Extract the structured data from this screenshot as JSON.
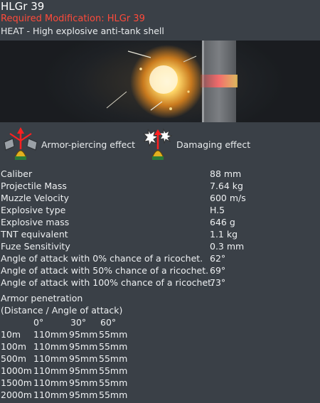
{
  "header": {
    "title": "HLGr 39",
    "required_modification": "Required Modification: HLGr 39",
    "description": "HEAT - High explosive anti-tank shell"
  },
  "effects": [
    {
      "label": "Armor-piercing effect",
      "icon": "armor-piercing-icon"
    },
    {
      "label": "Damaging effect",
      "icon": "damaging-effect-icon"
    }
  ],
  "stats": [
    {
      "label": "Caliber",
      "value": "88 mm"
    },
    {
      "label": "Projectile Mass",
      "value": "7.64 kg"
    },
    {
      "label": "Muzzle Velocity",
      "value": "600 m/s"
    },
    {
      "label": "Explosive type",
      "value": "H.5"
    },
    {
      "label": "Explosive mass",
      "value": "646 g"
    },
    {
      "label": "TNT equivalent",
      "value": "1.1 kg"
    },
    {
      "label": "Fuze Sensitivity",
      "value": "0.3 mm"
    },
    {
      "label": "Angle of attack with 0% chance of a ricochet.",
      "value": "62°"
    },
    {
      "label": "Angle of attack with 50% chance of a ricochet.",
      "value": "69°"
    },
    {
      "label": "Angle of attack with 100% chance of a ricochet.",
      "value": "73°"
    }
  ],
  "penetration": {
    "title": "Armor penetration",
    "subtitle": "(Distance / Angle of attack)",
    "angles": [
      "0°",
      "30°",
      "60°"
    ],
    "rows": [
      {
        "distance": "10m",
        "values": [
          "110mm",
          "95mm",
          "55mm"
        ]
      },
      {
        "distance": "100m",
        "values": [
          "110mm",
          "95mm",
          "55mm"
        ]
      },
      {
        "distance": "500m",
        "values": [
          "110mm",
          "95mm",
          "55mm"
        ]
      },
      {
        "distance": "1000m",
        "values": [
          "110mm",
          "95mm",
          "55mm"
        ]
      },
      {
        "distance": "1500m",
        "values": [
          "110mm",
          "95mm",
          "55mm"
        ]
      },
      {
        "distance": "2000m",
        "values": [
          "110mm",
          "95mm",
          "55mm"
        ]
      }
    ]
  }
}
